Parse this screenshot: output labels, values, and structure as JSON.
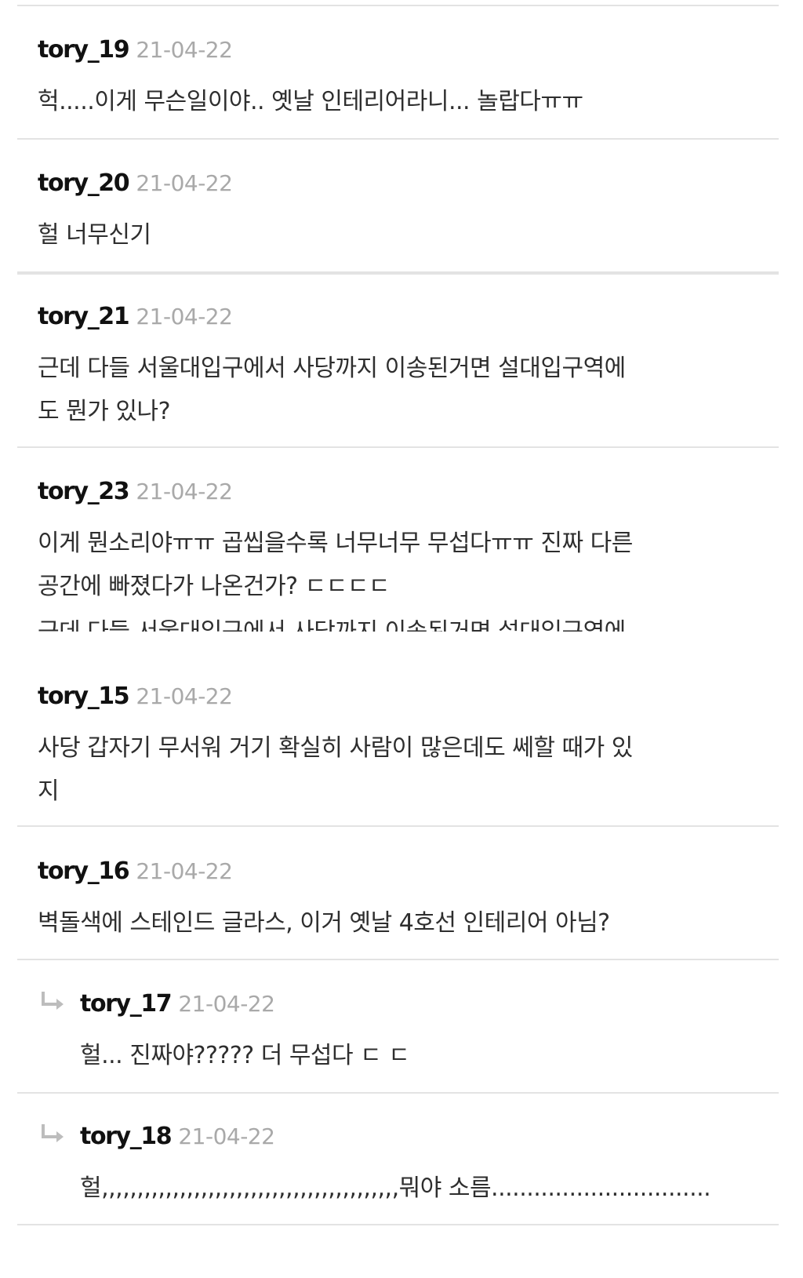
{
  "comments": [
    {
      "user": "tory_19",
      "date": "21-04-22",
      "lines": [
        "헉.....이게 무슨일이야.. 옛날 인테리어라니... 놀랍다ㅠㅠ"
      ]
    },
    {
      "user": "tory_20",
      "date": "21-04-22",
      "lines": [
        "헐 너무신기"
      ]
    },
    {
      "user": "tory_21",
      "date": "21-04-22",
      "lines": [
        "근데 다들 서울대입구에서 사당까지 이송된거면 설대입구역에",
        "도 뭔가 있나?"
      ]
    },
    {
      "user": "tory_23",
      "date": "21-04-22",
      "lines": [
        "이게 뭔소리야ㅠㅠ 곱씹을수록 너무너무 무섭다ㅠㅠ 진짜 다른",
        "공간에 빠졌다가 나온건가? ㄷㄷㄷㄷ"
      ],
      "clipped_line": "근데 다들 서울대입구에서 사당까지 이송된거면 설대입구역에"
    },
    {
      "user": "tory_15",
      "date": "21-04-22",
      "lines": [
        "사당 갑자기 무서워 거기 확실히 사람이 많은데도 쎄할 때가 있",
        "지"
      ]
    },
    {
      "user": "tory_16",
      "date": "21-04-22",
      "lines": [
        "벽돌색에 스테인드 글라스, 이거 옛날 4호선 인테리어 아님?"
      ]
    },
    {
      "user": "tory_17",
      "date": "21-04-22",
      "reply": true,
      "lines": [
        "헐... 진짜야????? 더 무섭다 ㄷ ㄷ"
      ]
    },
    {
      "user": "tory_18",
      "date": "21-04-22",
      "reply": true,
      "lines": [
        "헐,,,,,,,,,,,,,,,,,,,,,,,,,,,,,,,,,,,,,,,,,,뭐야 소름..............................."
      ]
    }
  ],
  "icons": {
    "reply": "reply-arrow-icon"
  },
  "colors": {
    "username": "#111111",
    "date": "#a9a9a9",
    "divider": "#e3e3e3",
    "reply_arrow": "#bdbdbd"
  }
}
